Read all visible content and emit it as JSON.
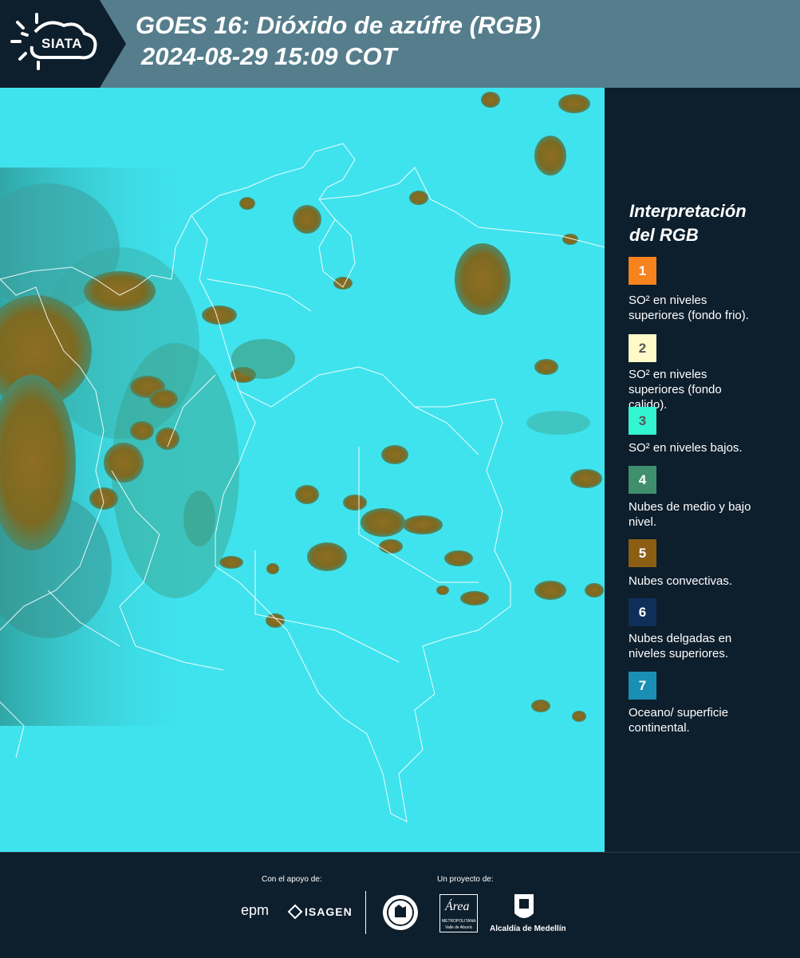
{
  "header": {
    "logo_text": "SIATA",
    "title_line1": "GOES 16: Dióxido de azúfre (RGB)",
    "title_line2": "2024-08-29 15:09 COT",
    "background_color": "#557d8c"
  },
  "legend": {
    "title_line1": "Interpretación",
    "title_line2": "del RGB",
    "items": [
      {
        "number": "1",
        "color": "#f7821e",
        "number_color": "#ffffff",
        "label_line1": "SO² en niveles",
        "label_line2": "superiores (fondo frio)."
      },
      {
        "number": "2",
        "color": "#fffac8",
        "number_color": "#555555",
        "label_line1": "SO² en niveles",
        "label_line2": "superiores (fondo",
        "label_line3": "calido)."
      },
      {
        "number": "3",
        "color": "#34f5d2",
        "number_color": "#555555",
        "label_line1": "SO² en niveles bajos."
      },
      {
        "number": "4",
        "color": "#3f8f6d",
        "number_color": "#ffffff",
        "label_line1": "Nubes de medio y bajo",
        "label_line2": "nivel."
      },
      {
        "number": "5",
        "color": "#8b5e13",
        "number_color": "#ffffff",
        "label_line1": "Nubes convectivas."
      },
      {
        "number": "6",
        "color": "#0e2f5a",
        "number_color": "#ffffff",
        "label_line1": "Nubes delgadas en",
        "label_line2": "niveles superiores."
      },
      {
        "number": "7",
        "color": "#1a8fb3",
        "number_color": "#ffffff",
        "label_line1": "Oceano/ superficie",
        "label_line2": "continental."
      }
    ]
  },
  "footer": {
    "support_label": "Con el apoyo de:",
    "project_label": "Un proyecto de:",
    "epm_logo": "epm",
    "isagen_logo": "ISAGEN",
    "area_logo": "Área",
    "area_subtitle": "METROPOLITANA",
    "area_subtitle2": "Valle de Aburrá",
    "alcaldia_logo": "Alcaldía de Medellín"
  },
  "map": {
    "surface_color": "#3fe3ee",
    "convective_cloud_color": "#8b6a1e",
    "mid_cloud_color": "#3f8f6d",
    "border_color": "#ffffff"
  }
}
